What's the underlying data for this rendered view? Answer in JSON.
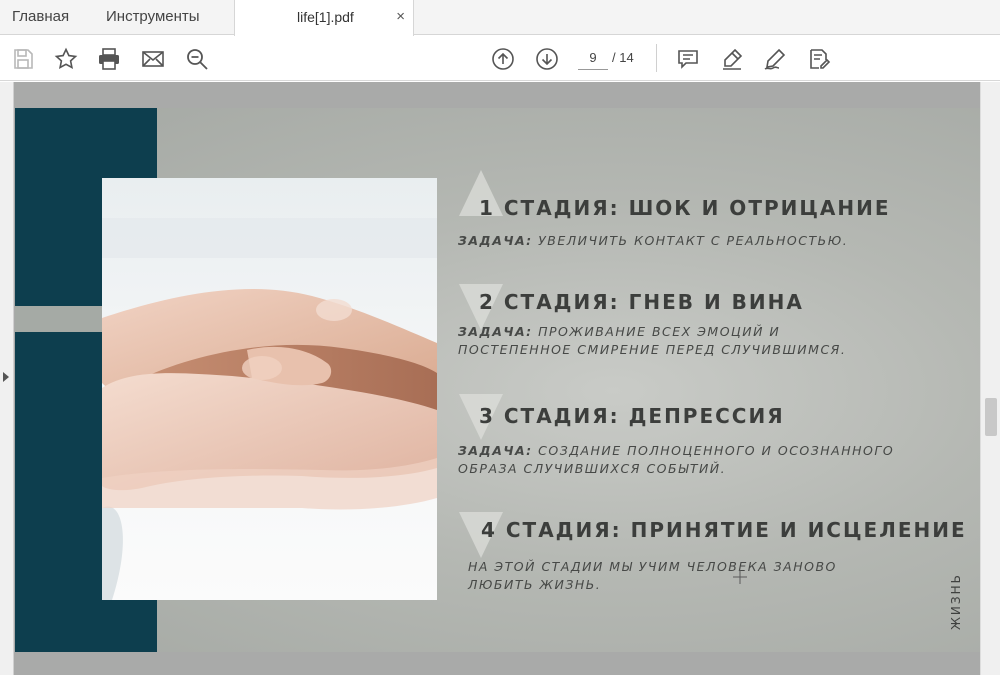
{
  "tabs": {
    "home": "Главная",
    "tools": "Инструменты",
    "document": "life[1].pdf",
    "close_symbol": "×"
  },
  "toolbar": {
    "icons": [
      "save-icon",
      "bookmark-star-icon",
      "print-icon",
      "email-icon",
      "zoom-search-icon",
      "page-up-icon",
      "page-down-icon",
      "comment-icon",
      "highlight-pen-icon",
      "sign-icon",
      "edit-form-icon"
    ],
    "current_page": "9",
    "total_pages": "/ 14"
  },
  "slide": {
    "stages": [
      {
        "title": "1 СТАДИЯ: ШОК И ОТРИЦАНИЕ",
        "task_label": "ЗАДАЧА:",
        "task_lines": [
          "УВЕЛИЧИТЬ КОНТАКТ С РЕАЛЬНОСТЬЮ."
        ]
      },
      {
        "title": "2 СТАДИЯ: ГНЕВ И ВИНА",
        "task_label": "ЗАДАЧА:",
        "task_lines": [
          "ПРОЖИВАНИЕ ВСЕХ ЭМОЦИЙ И",
          "ПОСТЕПЕННОЕ СМИРЕНИЕ ПЕРЕД СЛУЧИВШИМСЯ."
        ]
      },
      {
        "title": "3 СТАДИЯ: ДЕПРЕССИЯ",
        "task_label": "ЗАДАЧА:",
        "task_lines": [
          "СОЗДАНИЕ ПОЛНОЦЕННОГО И ОСОЗНАННОГО",
          "ОБРАЗА СЛУЧИВШИХСЯ СОБЫТИЙ."
        ]
      },
      {
        "title": "4 СТАДИЯ: ПРИНЯТИЕ И ИСЦЕЛЕНИЕ",
        "task_label": "",
        "task_lines": [
          "НА ЭТОЙ СТАДИИ МЫ УЧИМ ЧЕЛОВЕКА ЗАНОВО",
          "ЛЮБИТЬ ЖИЗНЬ."
        ]
      }
    ],
    "side_word": "ЖИЗНЬ",
    "colors": {
      "dark_bar": "#0d3e4e",
      "background": "#b5b8b3",
      "text": "#3c3e3c"
    }
  }
}
